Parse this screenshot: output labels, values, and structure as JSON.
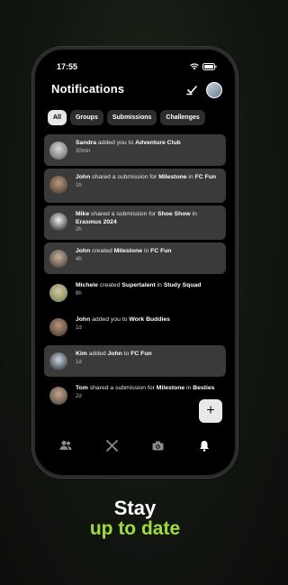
{
  "status": {
    "time": "17:55"
  },
  "header": {
    "title": "Notifications"
  },
  "filters": [
    "All",
    "Groups",
    "Submissions",
    "Challenges"
  ],
  "notifications": [
    {
      "parts": [
        {
          "t": "Sandra",
          "b": true
        },
        {
          "t": " added you to ",
          "b": false
        },
        {
          "t": "Adventure Club",
          "b": true
        }
      ],
      "time": "30min",
      "unread": true
    },
    {
      "parts": [
        {
          "t": "John",
          "b": true
        },
        {
          "t": " shared a submission for ",
          "b": false
        },
        {
          "t": "Milestone",
          "b": true
        },
        {
          "t": " in ",
          "b": false
        },
        {
          "t": "FC Fun",
          "b": true
        }
      ],
      "time": "1h",
      "unread": true
    },
    {
      "parts": [
        {
          "t": "Mike",
          "b": true
        },
        {
          "t": " shared a submission for ",
          "b": false
        },
        {
          "t": "Shoe Show",
          "b": true
        },
        {
          "t": " in ",
          "b": false
        },
        {
          "t": "Erasmus 2024",
          "b": true
        }
      ],
      "time": "2h",
      "unread": true
    },
    {
      "parts": [
        {
          "t": "John",
          "b": true
        },
        {
          "t": " created ",
          "b": false
        },
        {
          "t": "Milestone",
          "b": true
        },
        {
          "t": " in ",
          "b": false
        },
        {
          "t": "FC Fun",
          "b": true
        }
      ],
      "time": "4h",
      "unread": true
    },
    {
      "parts": [
        {
          "t": "Michele",
          "b": true
        },
        {
          "t": " created ",
          "b": false
        },
        {
          "t": "Supertalent",
          "b": true
        },
        {
          "t": " in ",
          "b": false
        },
        {
          "t": "Study Squad",
          "b": true
        }
      ],
      "time": "8h",
      "unread": false
    },
    {
      "parts": [
        {
          "t": "John",
          "b": true
        },
        {
          "t": " added you to ",
          "b": false
        },
        {
          "t": "Work Buddies",
          "b": true
        }
      ],
      "time": "1d",
      "unread": false
    },
    {
      "parts": [
        {
          "t": "Kim",
          "b": true
        },
        {
          "t": " added ",
          "b": false
        },
        {
          "t": "John",
          "b": true
        },
        {
          "t": " to ",
          "b": false
        },
        {
          "t": "FC Fun",
          "b": true
        }
      ],
      "time": "1d",
      "unread": true
    },
    {
      "parts": [
        {
          "t": "Tom",
          "b": true
        },
        {
          "t": " shared a submission for ",
          "b": false
        },
        {
          "t": "Milestone",
          "b": true
        },
        {
          "t": " in ",
          "b": false
        },
        {
          "t": "Besties",
          "b": true
        }
      ],
      "time": "2d",
      "unread": false
    }
  ],
  "fab": {
    "label": "+"
  },
  "promo": {
    "line1": "Stay",
    "line2": "up to date"
  },
  "colors": {
    "accent": "#9ee02a",
    "unread_bg": "#3a3a3a"
  }
}
